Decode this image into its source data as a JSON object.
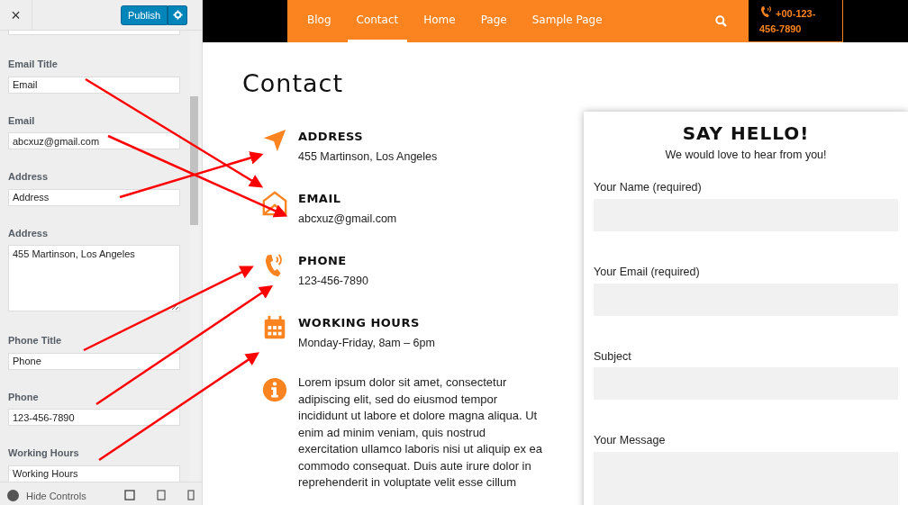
{
  "customizer": {
    "close": "×",
    "publish": "Publish",
    "fields": [
      {
        "kind": "input",
        "label": "Email Title",
        "value": "Email"
      },
      {
        "kind": "input",
        "label": "Email",
        "value": "abcxuz@gmail.com"
      },
      {
        "kind": "input",
        "label": "Address",
        "value": "Address"
      },
      {
        "kind": "textarea",
        "label": "Address",
        "value": "455 Martinson, Los Angeles"
      },
      {
        "kind": "input",
        "label": "Phone Title",
        "value": "Phone"
      },
      {
        "kind": "input",
        "label": "Phone",
        "value": "123-456-7890"
      },
      {
        "kind": "input",
        "label": "Working Hours",
        "value": "Working Hours"
      }
    ],
    "hide_controls": "Hide Controls"
  },
  "nav": {
    "items": [
      {
        "label": "Blog",
        "selected": false
      },
      {
        "label": "Contact",
        "selected": true
      },
      {
        "label": "Home",
        "selected": false
      },
      {
        "label": "Page",
        "selected": false
      },
      {
        "label": "Sample Page",
        "selected": false
      }
    ],
    "phone": "+00-123-456-7890"
  },
  "page_title": "Contact",
  "contacts": [
    {
      "kind": "address",
      "title": "ADDRESS",
      "text": "455 Martinson, Los Angeles"
    },
    {
      "kind": "email",
      "title": "EMAIL",
      "text": "abcxuz@gmail.com"
    },
    {
      "kind": "phone",
      "title": "PHONE",
      "text": "123-456-7890"
    },
    {
      "kind": "hours",
      "title": "WORKING HOURS",
      "text": "Monday-Friday, 8am – 6pm"
    },
    {
      "kind": "info",
      "text": "Lorem ipsum dolor sit amet, consectetur adipiscing elit, sed do eiusmod tempor incididunt ut labore et dolore magna aliqua. Ut enim ad minim veniam, quis nostrud exercitation ullamco laboris nisi ut aliquip ex ea commodo consequat. Duis aute irure dolor in reprehenderit in voluptate velit esse cillum"
    }
  ],
  "form": {
    "title": "SAY HELLO!",
    "subtitle": "We would love to hear from you!",
    "fields": [
      {
        "kind": "input",
        "label": "Your Name (required)"
      },
      {
        "kind": "input",
        "label": "Your Email (required)"
      },
      {
        "kind": "input",
        "label": "Subject"
      },
      {
        "kind": "textarea",
        "label": "Your Message"
      }
    ]
  }
}
